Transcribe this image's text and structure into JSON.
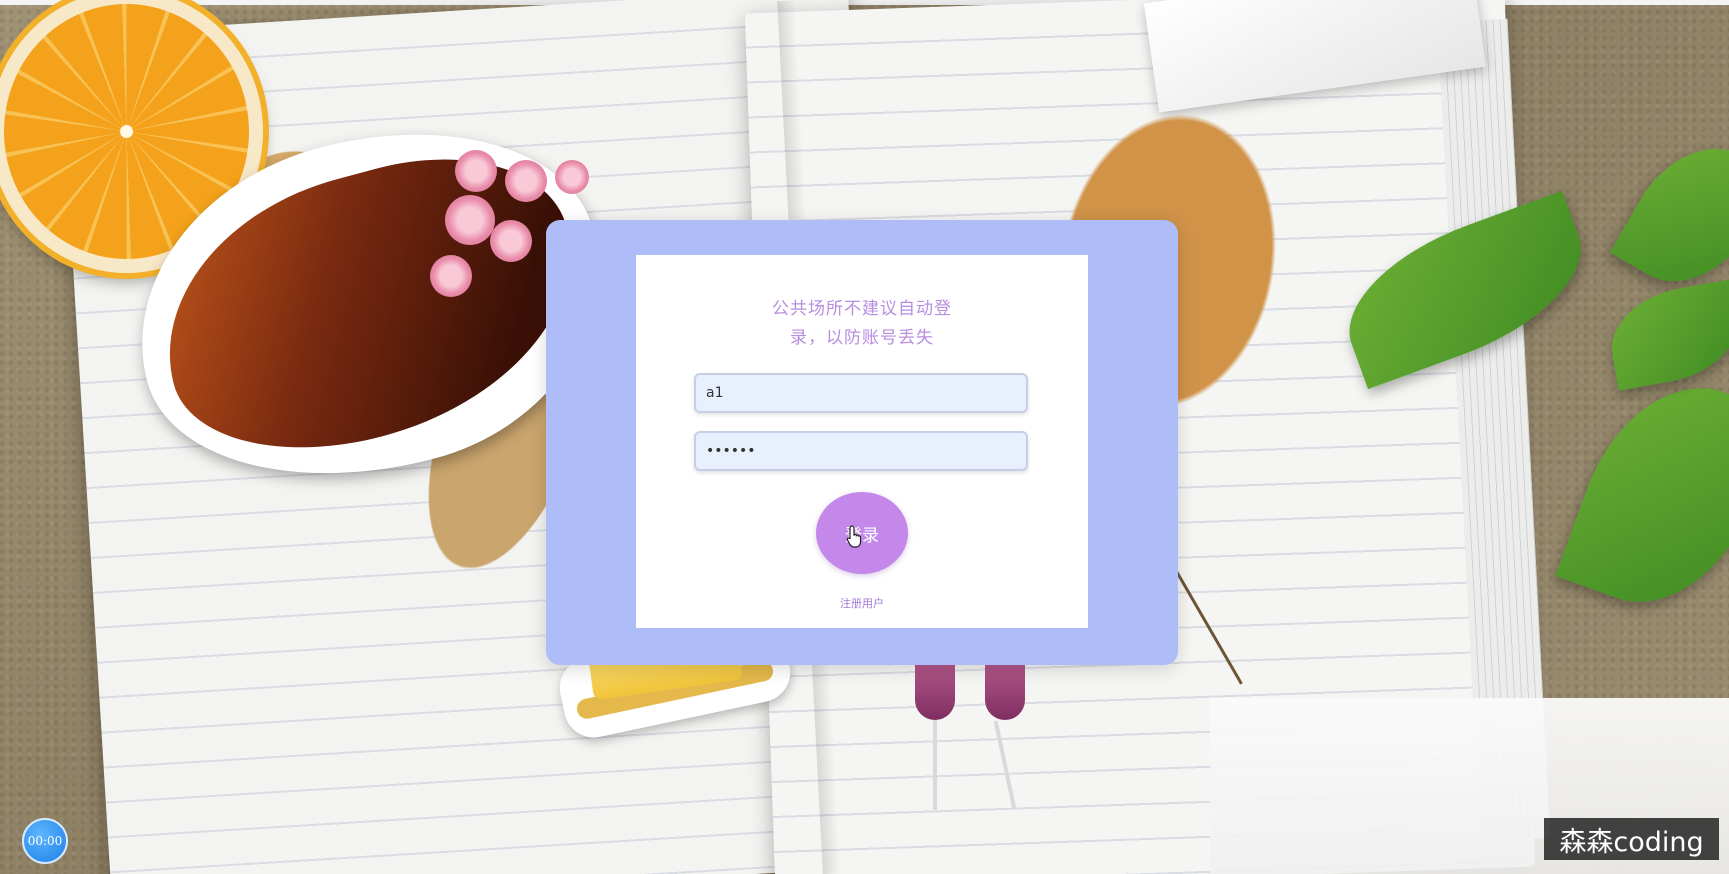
{
  "login": {
    "tip_line1": "公共场所不建议自动登",
    "tip_line2": "录，以防账号丢失",
    "username_value": "a1",
    "password_value": "••••••",
    "login_button_label": "登录",
    "register_link_label": "注册用户"
  },
  "overlay": {
    "timer_text": "00:00",
    "watermark_text": "森森coding"
  },
  "colors": {
    "card_outer": "#aebcf7",
    "card_inner": "#ffffff",
    "accent_purple": "#c488ea",
    "tip_text": "#b78ee0",
    "input_bg": "#e8f0fe"
  },
  "icons": {
    "cursor": "hand-pointer-icon"
  }
}
